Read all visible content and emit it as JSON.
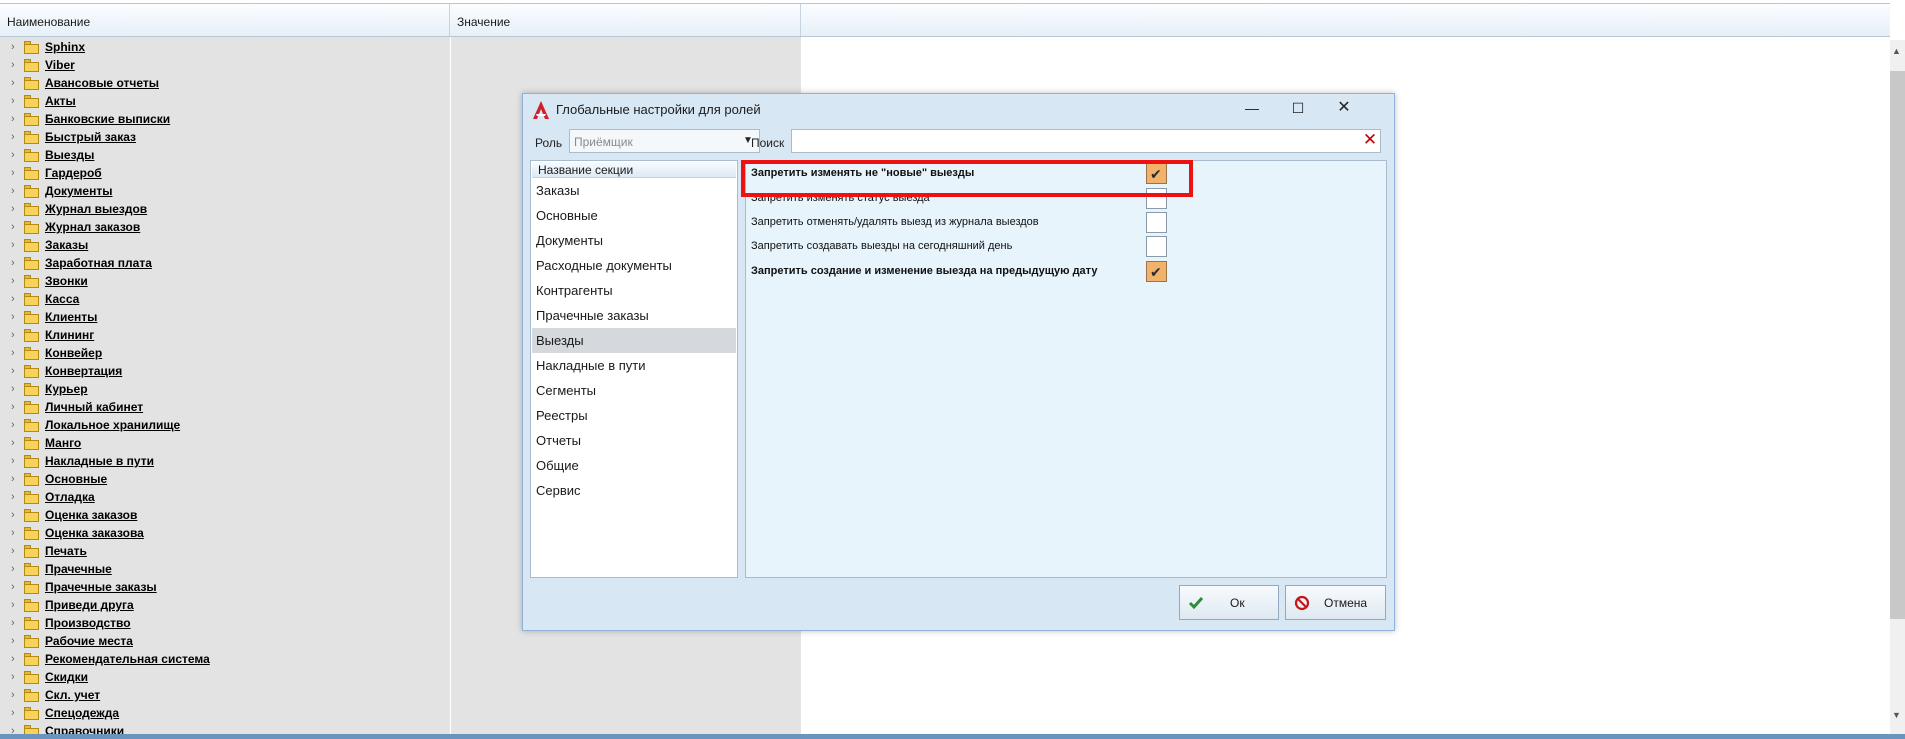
{
  "grid": {
    "columns": [
      "Наименование",
      "Значение"
    ],
    "items": [
      "Sphinx",
      "Viber",
      "Авансовые отчеты",
      "Акты",
      "Банковские выписки",
      "Быстрый заказ",
      "Выезды",
      "Гардероб",
      "Документы",
      "Журнал выездов",
      "Журнал заказов",
      "Заказы",
      "Заработная плата",
      "Звонки",
      "Касса",
      "Клиенты",
      "Клининг",
      "Конвейер",
      "Конвертация",
      "Курьер",
      "Личный кабинет",
      "Локальное хранилище",
      "Манго",
      "Накладные в пути",
      "Основные",
      "Отладка",
      "Оценка заказов",
      "Оценка заказова",
      "Печать",
      "Прачечные",
      "Прачечные заказы",
      "Приведи друга",
      "Производство",
      "Рабочие места",
      "Рекомендательная система",
      "Скидки",
      "Скл. учет",
      "Спецодежда",
      "Справочники"
    ]
  },
  "dialog": {
    "title": "Глобальные настройки для ролей",
    "role_label": "Роль",
    "role_value": "Приёмщик",
    "search_label": "Поиск",
    "search_value": "",
    "sections_header": "Название секции",
    "sections": [
      "Заказы",
      "Основные",
      "Документы",
      "Расходные документы",
      "Контрагенты",
      "Прачечные заказы",
      "Выезды",
      "Накладные в пути",
      "Сегменты",
      "Реестры",
      "Отчеты",
      "Общие",
      "Сервис"
    ],
    "active_section": "Выезды",
    "settings": [
      {
        "label": "Запретить изменять не \"новые\" выезды",
        "checked": true,
        "bold": true
      },
      {
        "label": "Запретить изменять статус выезда",
        "checked": false,
        "bold": false
      },
      {
        "label": "Запретить отменять/удалять выезд из журнала выездов",
        "checked": false,
        "bold": false
      },
      {
        "label": "Запретить создавать выезды на сегодняшний день",
        "checked": false,
        "bold": false
      },
      {
        "label": "Запретить создание и изменение выезда на предыдущую дату",
        "checked": true,
        "bold": true
      }
    ],
    "ok_label": "Ок",
    "cancel_label": "Отмена",
    "colors": {
      "highlight": "#ee1111",
      "checked_fill": "#f3b26b",
      "ok_icon": "#2e8b3a",
      "cancel_icon": "#c01818"
    },
    "icons": {
      "logo": "app-logo-icon",
      "clear": "clear-x-icon",
      "ok": "checkmark-icon",
      "cancel": "prohibited-icon"
    }
  }
}
